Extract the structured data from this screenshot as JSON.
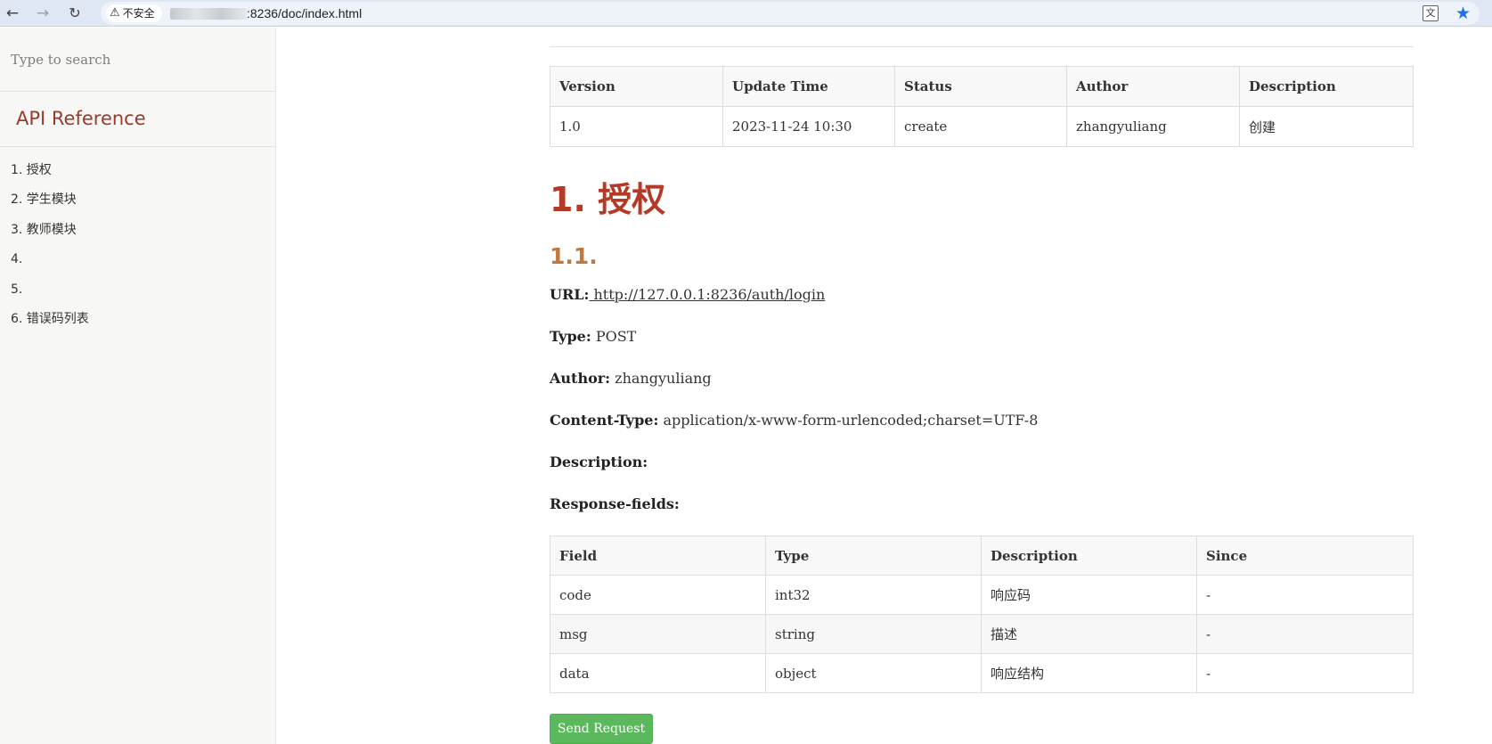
{
  "browser": {
    "security_label": "不安全",
    "url": ":8236/doc/index.html"
  },
  "sidebar": {
    "search_placeholder": "Type to search",
    "title": "API Reference",
    "items": [
      {
        "label": "1. 授权"
      },
      {
        "label": "2. 学生模块"
      },
      {
        "label": "3. 教师模块"
      },
      {
        "label": "4."
      },
      {
        "label": "5."
      },
      {
        "label": "6. 错误码列表"
      }
    ]
  },
  "version_table": {
    "headers": [
      "Version",
      "Update Time",
      "Status",
      "Author",
      "Description"
    ],
    "rows": [
      [
        "1.0",
        "2023-11-24 10:30",
        "create",
        "zhangyuliang",
        "创建"
      ]
    ]
  },
  "section": {
    "title": "1. 授权",
    "subtitle": "1.1.",
    "url_label": "URL:",
    "url_value": " http://127.0.0.1:8236/auth/login",
    "type_label": "Type:",
    "type_value": "POST",
    "author_label": "Author:",
    "author_value": "zhangyuliang",
    "content_type_label": "Content-Type:",
    "content_type_value": "application/x-www-form-urlencoded;charset=UTF-8",
    "description_label": "Description:",
    "response_label": "Response-fields:"
  },
  "response_table": {
    "headers": [
      "Field",
      "Type",
      "Description",
      "Since"
    ],
    "rows": [
      [
        "code",
        "int32",
        "响应码",
        "-"
      ],
      [
        "msg",
        "string",
        "描述",
        "-"
      ],
      [
        "data",
        "object",
        "响应结构",
        "-"
      ]
    ]
  },
  "send_button_label": "Send Request"
}
